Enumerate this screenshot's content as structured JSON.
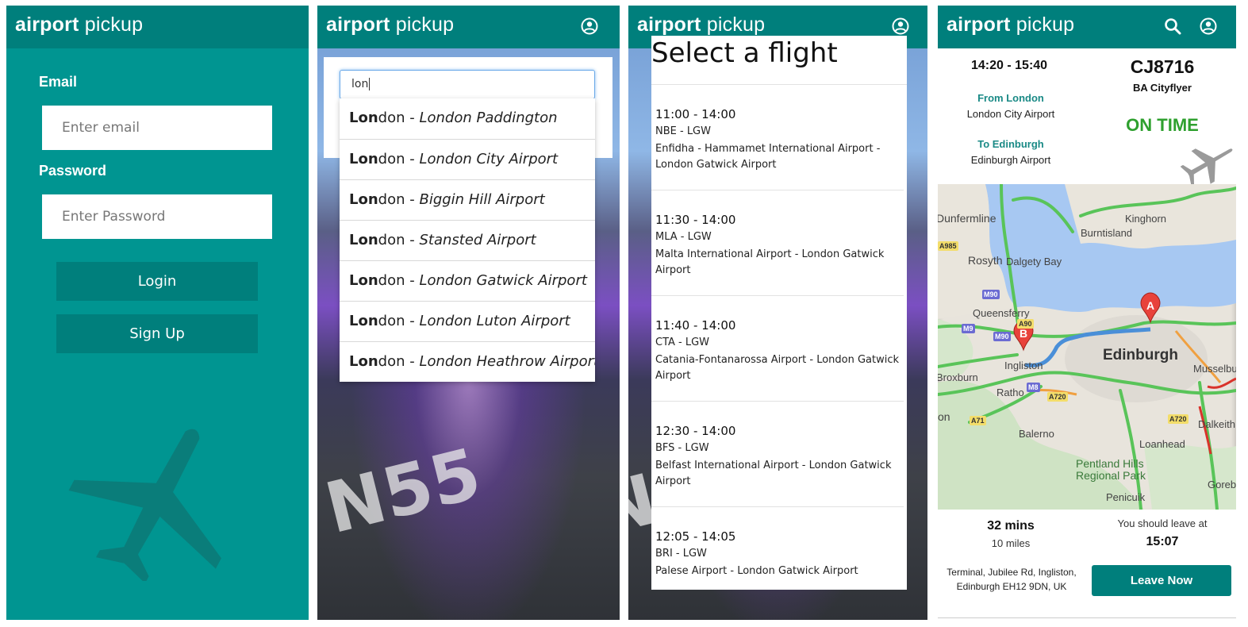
{
  "app": {
    "brand_bold": "airport",
    "brand_light": " pickup"
  },
  "login": {
    "email_label": "Email",
    "email_placeholder": "Enter email",
    "password_label": "Password",
    "password_placeholder": "Enter Password",
    "login_button": "Login",
    "signup_button": "Sign Up"
  },
  "search": {
    "query": "lon",
    "results": [
      {
        "match": "Lon",
        "rest": "don",
        "sep": " - ",
        "airport": "London Paddington"
      },
      {
        "match": "Lon",
        "rest": "don",
        "sep": " - ",
        "airport": "London City Airport"
      },
      {
        "match": "Lon",
        "rest": "don",
        "sep": " - ",
        "airport": "Biggin Hill Airport"
      },
      {
        "match": "Lon",
        "rest": "don",
        "sep": " - ",
        "airport": "Stansted Airport"
      },
      {
        "match": "Lon",
        "rest": "don",
        "sep": " - ",
        "airport": "London Gatwick Airport"
      },
      {
        "match": "Lon",
        "rest": "don",
        "sep": " - ",
        "airport": "London Luton Airport"
      },
      {
        "match": "Lon",
        "rest": "don",
        "sep": " - ",
        "airport": "London Heathrow Airport"
      }
    ]
  },
  "flights": {
    "title": "Select a flight",
    "items": [
      {
        "time": "11:00 - 14:00",
        "codes": "NBE - LGW",
        "airports": "Enfidha - Hammamet International Airport - London Gatwick Airport"
      },
      {
        "time": "11:30 - 14:00",
        "codes": "MLA - LGW",
        "airports": "Malta International Airport - London Gatwick Airport"
      },
      {
        "time": "11:40 - 14:00",
        "codes": "CTA - LGW",
        "airports": "Catania-Fontanarossa Airport - London Gatwick Airport"
      },
      {
        "time": "12:30 - 14:00",
        "codes": "BFS - LGW",
        "airports": "Belfast International Airport - London Gatwick Airport"
      },
      {
        "time": "12:05 - 14:05",
        "codes": "BRI - LGW",
        "airports": "Palese Airport - London Gatwick Airport"
      }
    ]
  },
  "details": {
    "time": "14:20 - 15:40",
    "from_label": "From London",
    "from_airport": "London City Airport",
    "to_label": "To Edinburgh",
    "to_airport": "Edinburgh Airport",
    "flight_number": "CJ8716",
    "airline": "BA Cityflyer",
    "status": "ON TIME",
    "status_color": "#2ea02e",
    "duration": "32 mins",
    "distance": "10 miles",
    "leave_label": "You should leave at",
    "leave_time": "15:07",
    "address_line1": "Terminal, Jubilee Rd, Ingliston,",
    "address_line2": "Edinburgh EH12 9DN, UK",
    "leave_button": "Leave Now",
    "map": {
      "labels": {
        "dunfermline": "Dunfermline",
        "kinghorn": "Kinghorn",
        "burntisland": "Burntisland",
        "rosyth": "Rosyth",
        "dalgety": "Dalgety Bay",
        "queensferry": "Queensferry",
        "edinburgh": "Edinburgh",
        "ingliston": "Ingliston",
        "broxburn": "Broxburn",
        "ratho": "Ratho",
        "musselburgh": "Musselbu",
        "dalkeith": "Dalkeith",
        "balerno": "Balerno",
        "loanhead": "Loanhead",
        "pentland": "Pentland Hills",
        "regional": "Regional Park",
        "penicuik": "Penicuik",
        "gorebridge": "Goreb",
        "on": "on"
      },
      "roads": [
        "A985",
        "M90",
        "M9",
        "M90",
        "A90",
        "M8",
        "A720",
        "A71",
        "A720"
      ],
      "marker_a": "A",
      "marker_b": "B"
    }
  },
  "colors": {
    "brand_teal": "#009591",
    "header_teal": "#007f7c",
    "link_teal": "#1a8a86"
  },
  "icons": {
    "account": "account-circle-icon",
    "search": "search-icon",
    "plane": "airplane-icon"
  }
}
